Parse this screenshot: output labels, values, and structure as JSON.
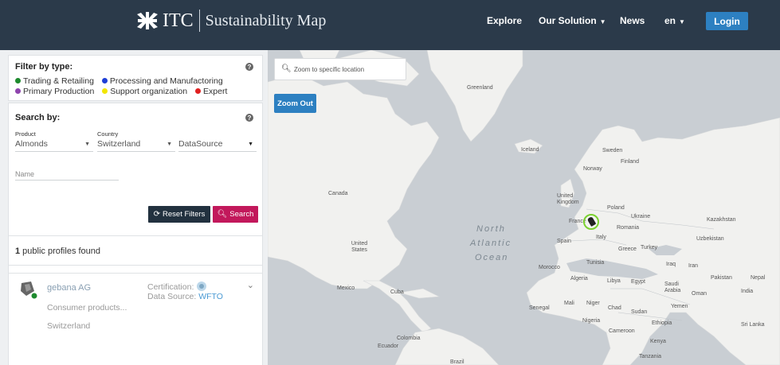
{
  "header": {
    "logo_text": "ITC",
    "title": "Sustainability Map",
    "nav": {
      "explore": "Explore",
      "our_solution": "Our Solution",
      "news": "News",
      "language": "en"
    },
    "login_label": "Login"
  },
  "filter_by_type": {
    "title": "Filter by type:",
    "types": [
      {
        "label": "Trading & Retailing",
        "color": "#1e8a2e"
      },
      {
        "label": "Processing and Manufactoring",
        "color": "#1f3fd6"
      },
      {
        "label": "Primary Production",
        "color": "#8e44ad"
      },
      {
        "label": "Support organization",
        "color": "#f2e600"
      },
      {
        "label": "Expert",
        "color": "#e02020"
      }
    ]
  },
  "search_by": {
    "title": "Search by:",
    "product_label": "Product",
    "product_value": "Almonds",
    "country_label": "Country",
    "country_value": "Switzerland",
    "datasource_value": "DataSource",
    "name_placeholder": "Name",
    "reset_label": "Reset Filters",
    "search_label": "Search"
  },
  "results": {
    "count": "1",
    "count_suffix": " public profiles found",
    "profiles": [
      {
        "name": "gebana AG",
        "category": "Consumer products...",
        "country": "Switzerland",
        "certification_label": "Certification:",
        "datasource_label": "Data Source:",
        "datasource_value": "WFTO"
      }
    ]
  },
  "map": {
    "search_placeholder": "Zoom to specific location",
    "zoom_out_label": "Zoom Out",
    "ocean": [
      "North",
      "Atlantic",
      "Ocean"
    ],
    "labels": [
      "Greenland",
      "Iceland",
      "Sweden",
      "Finland",
      "Norway",
      "Canada",
      "United Kingdom",
      "Poland",
      "Ukraine",
      "Kazakhstan",
      "France",
      "Romania",
      "Spain",
      "Italy",
      "Uzbekistan",
      "Greece",
      "Turkey",
      "United States",
      "Tunisia",
      "Iraq",
      "Iran",
      "Morocco",
      "Algeria",
      "Libya",
      "Egypt",
      "Pakistan",
      "Nepal",
      "Saudi Arabia",
      "Oman",
      "India",
      "Mexico",
      "Cuba",
      "Mali",
      "Niger",
      "Chad",
      "Yemen",
      "Senegal",
      "Sudan",
      "Nigeria",
      "Ethiopia",
      "Sri Lanka",
      "Cameroon",
      "Kenya",
      "Colombia",
      "Ecuador",
      "Tanzania",
      "Brazil"
    ]
  },
  "colors": {
    "header_bg": "#2b3a4a",
    "accent_blue": "#2d80c1",
    "search_btn": "#c2185b",
    "reset_btn": "#22313f",
    "map_water": "#c9ced3",
    "map_land": "#f1f1ef",
    "marker": "#7bd12f"
  }
}
